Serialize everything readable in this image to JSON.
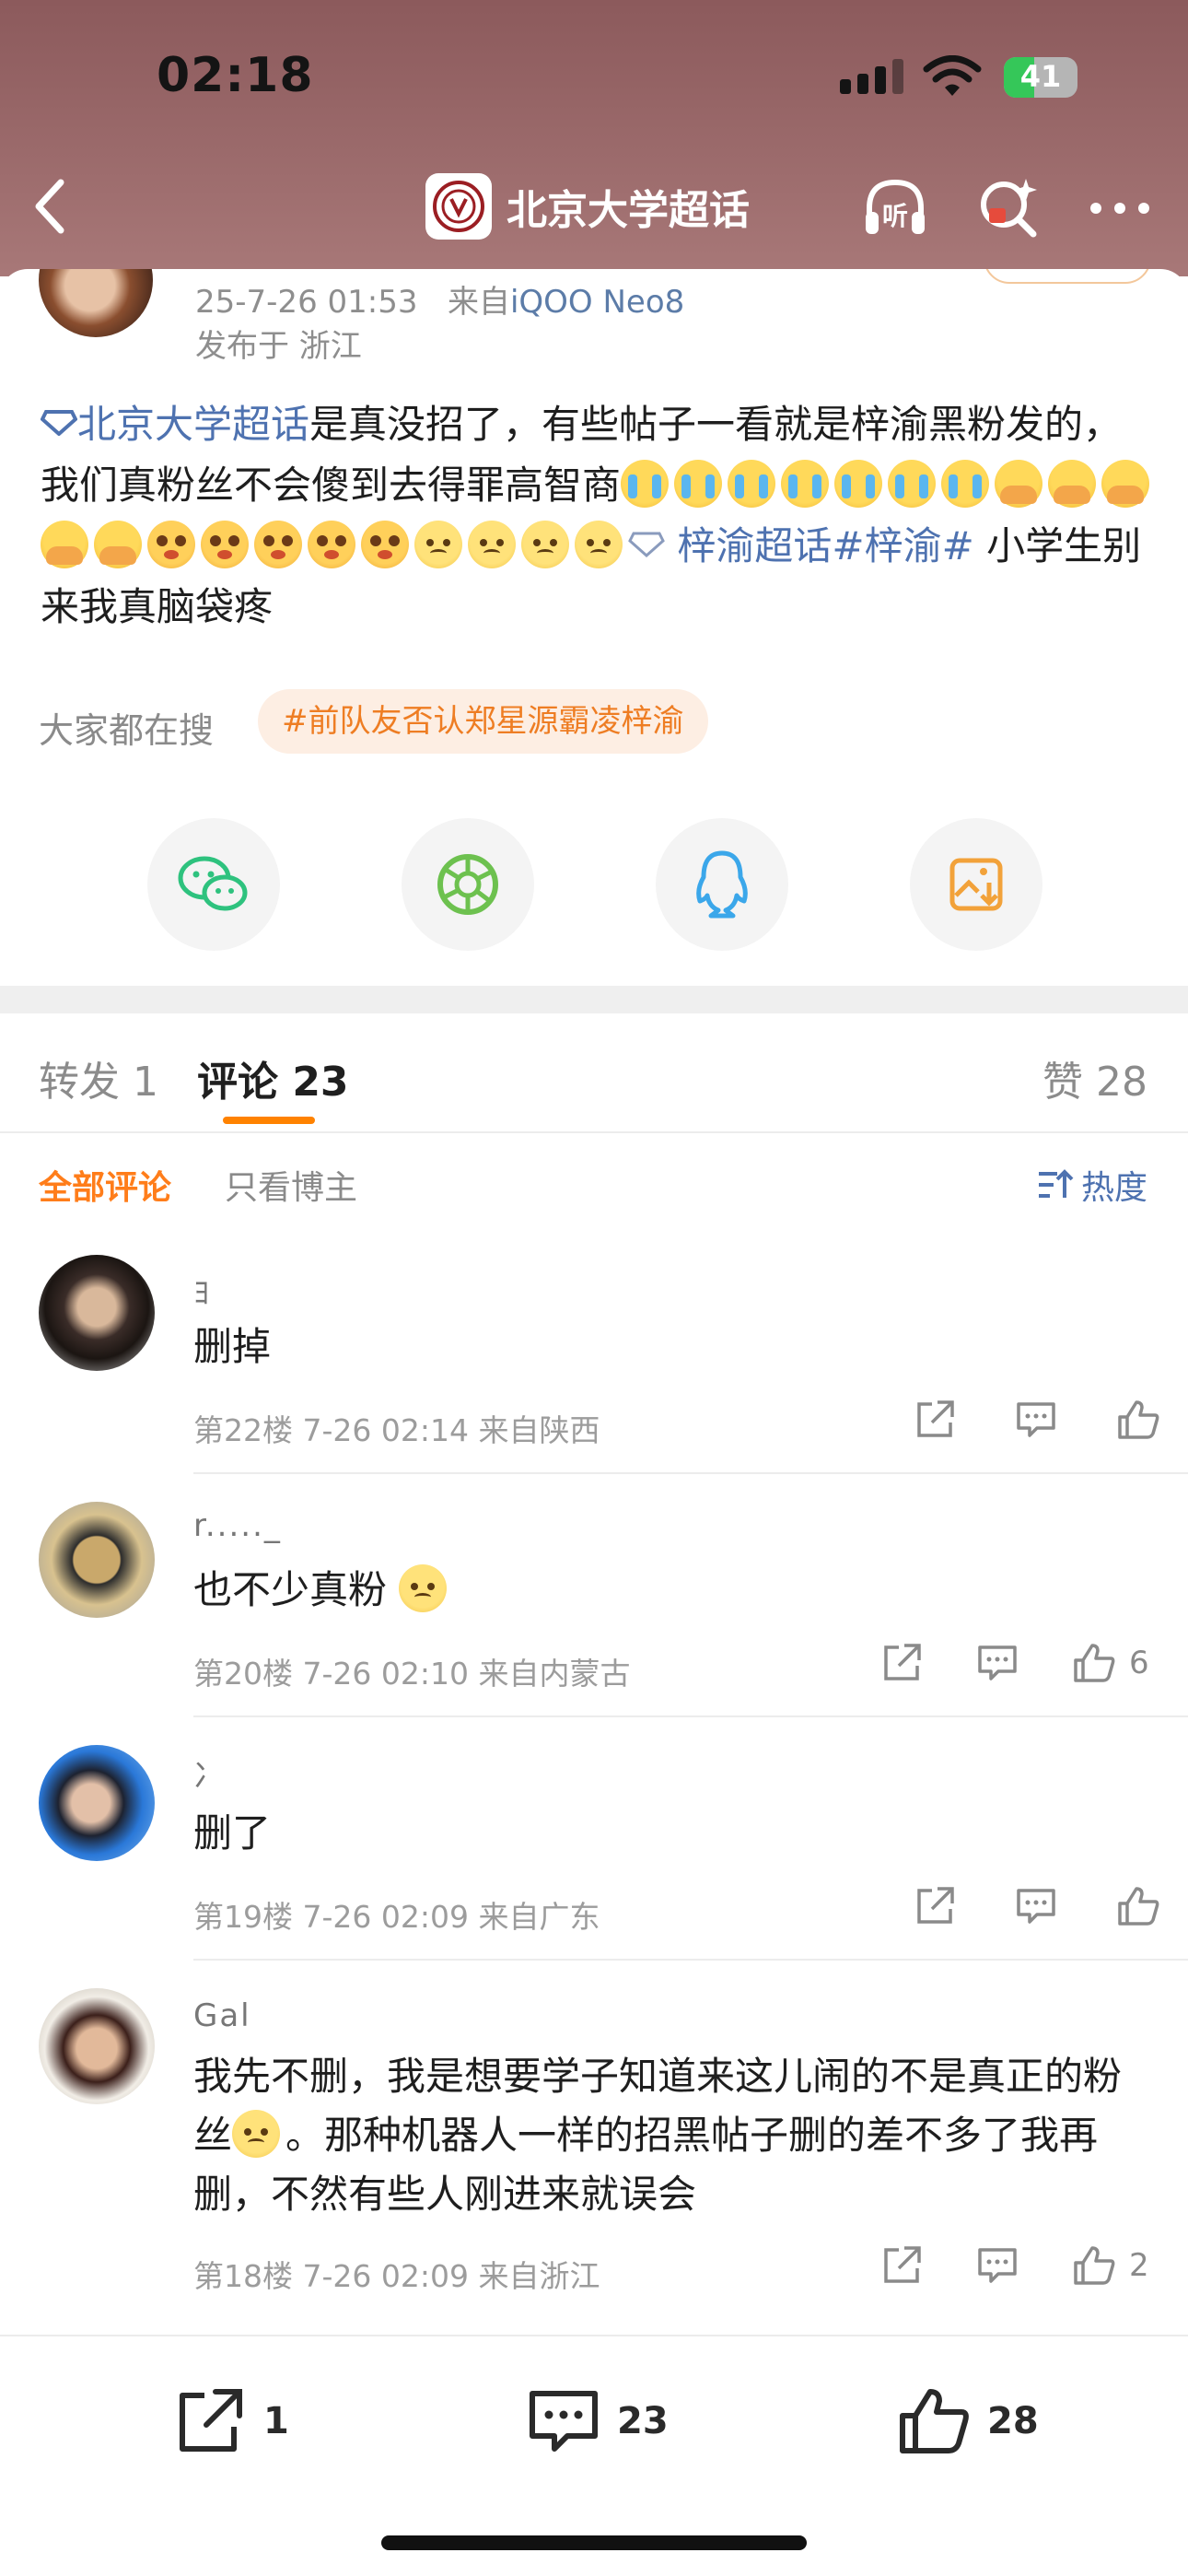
{
  "status_bar": {
    "time": "02:18",
    "battery": "41"
  },
  "nav": {
    "title": "北京大学超话"
  },
  "post": {
    "datetime": "25-7-26 01:53",
    "source_prefix": "来自",
    "device": "iQOO Neo8",
    "location": "发布于 浙江",
    "topic_tag": "北京大学超话",
    "text_part1": "是真没招了，有些帖子一看就是梓渝黑粉发的，我们真粉丝不会傻到去得罪高智商",
    "tag2": "梓渝超话",
    "tag3": "#梓渝#",
    "text_part2": " 小学生别来我真脑袋疼",
    "emoji": [
      "cry",
      "cry",
      "cry",
      "cry",
      "cry",
      "cry",
      "cry",
      "cover",
      "cover",
      "cover",
      "cover",
      "cover",
      "plead",
      "plead",
      "plead",
      "plead",
      "plead",
      "sad",
      "sad",
      "sad",
      "sad"
    ]
  },
  "search": {
    "label": "大家都在搜",
    "tag": "#前队友否认郑星源霸凌梓渝"
  },
  "share_targets": [
    "wechat-icon",
    "moments-icon",
    "qq-icon",
    "save-image-icon"
  ],
  "tabs": {
    "repost": "转发 1",
    "comments": "评论 23",
    "likes": "赞 28"
  },
  "filters": {
    "all": "全部评论",
    "author_only": "只看博主",
    "sort": "热度"
  },
  "comments": [
    {
      "name": "ﾖ",
      "text": "删掉",
      "meta": "第22楼 7-26 02:14 来自陕西",
      "likes": ""
    },
    {
      "name": "r....._",
      "text": "也不少真粉",
      "meta": "第20楼 7-26 02:10 来自内蒙古",
      "likes": "6"
    },
    {
      "name": "冫",
      "text": "删了",
      "meta": "第19楼 7-26 02:09 来自广东",
      "likes": ""
    },
    {
      "name": "Gal",
      "text_a": "我先不删，我是想要学子知道来这儿闹的不是真正的粉丝",
      "text_b": "。那种机器人一样的招黑帖子删的差不多了我再删，不然有些人刚进来就误会",
      "meta": "第18楼 7-26 02:09 来自浙江",
      "likes": "2"
    }
  ],
  "bottom_bar": {
    "reposts": "1",
    "comments": "23",
    "likes": "28"
  },
  "colors": {
    "accent_orange": "#ff8200",
    "link_blue": "#4e72b0",
    "header_bg": "#9b6a6b"
  }
}
